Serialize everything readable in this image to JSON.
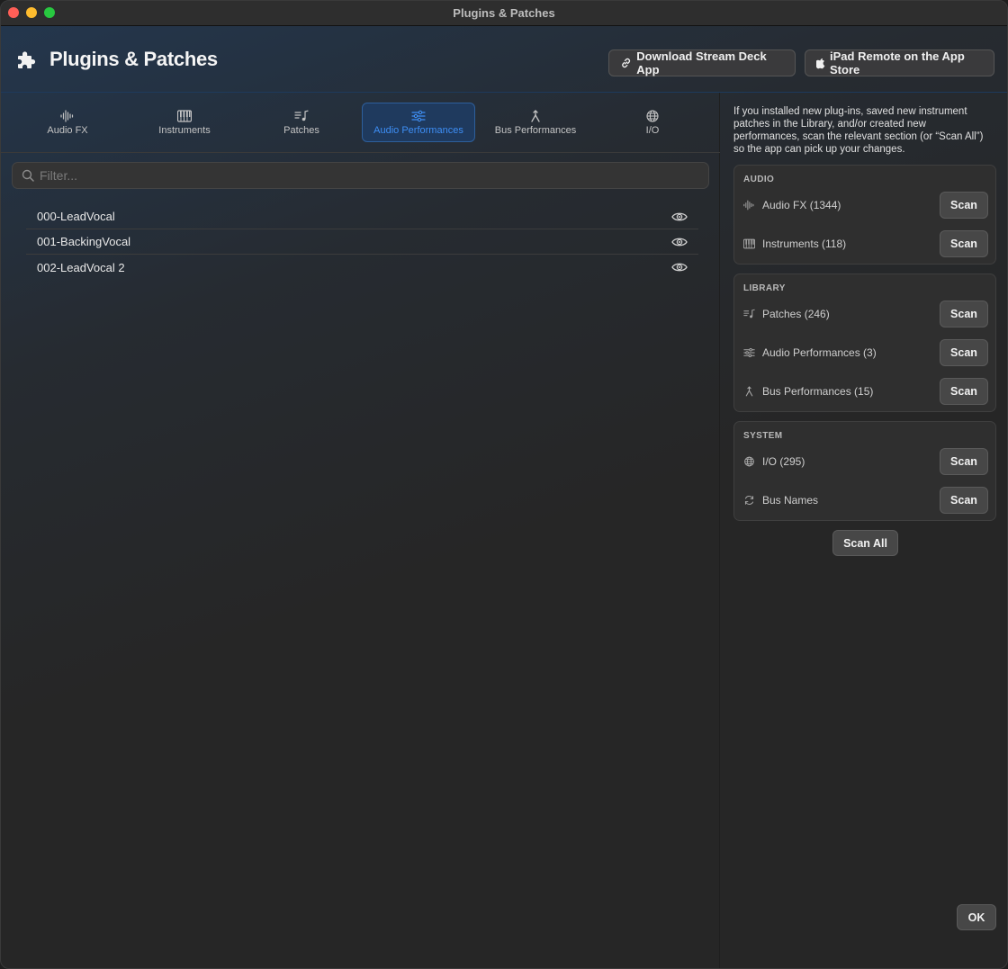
{
  "window": {
    "title": "Plugins & Patches"
  },
  "header": {
    "title": "Plugins & Patches",
    "download_button": "Download Stream Deck App",
    "ipad_button": "iPad Remote on the App Store"
  },
  "tabs": [
    {
      "label": "Audio FX",
      "icon": "waveform-icon"
    },
    {
      "label": "Instruments",
      "icon": "piano-icon"
    },
    {
      "label": "Patches",
      "icon": "music-list-icon"
    },
    {
      "label": "Audio Performances",
      "icon": "sliders-icon",
      "active": true
    },
    {
      "label": "Bus Performances",
      "icon": "merge-icon"
    },
    {
      "label": "I/O",
      "icon": "globe-icon"
    }
  ],
  "filter": {
    "placeholder": "Filter...",
    "value": ""
  },
  "list": [
    {
      "name": "000-LeadVocal"
    },
    {
      "name": "001-BackingVocal"
    },
    {
      "name": "002-LeadVocal 2"
    }
  ],
  "sidebar": {
    "info": "If you installed new plug-ins, saved new instrument patches in the Library, and/or created new performances, scan the relevant section (or “Scan All”) so the app can pick up your changes.",
    "groups": [
      {
        "title": "AUDIO",
        "rows": [
          {
            "label": "Audio FX (1344)",
            "icon": "waveform-icon",
            "button": "Scan"
          },
          {
            "label": "Instruments (118)",
            "icon": "piano-icon",
            "button": "Scan"
          }
        ]
      },
      {
        "title": "LIBRARY",
        "rows": [
          {
            "label": "Patches (246)",
            "icon": "music-list-icon",
            "button": "Scan"
          },
          {
            "label": "Audio Performances (3)",
            "icon": "sliders-icon",
            "button": "Scan"
          },
          {
            "label": "Bus Performances (15)",
            "icon": "merge-icon",
            "button": "Scan"
          }
        ]
      },
      {
        "title": "SYSTEM",
        "rows": [
          {
            "label": "I/O (295)",
            "icon": "globe-icon",
            "button": "Scan"
          },
          {
            "label": "Bus Names",
            "icon": "refresh-icon",
            "button": "Scan"
          }
        ]
      }
    ],
    "scan_all": "Scan All",
    "ok": "OK"
  },
  "colors": {
    "accent": "#3d8ef5",
    "active_tab_bg": "#1f3a5e"
  }
}
